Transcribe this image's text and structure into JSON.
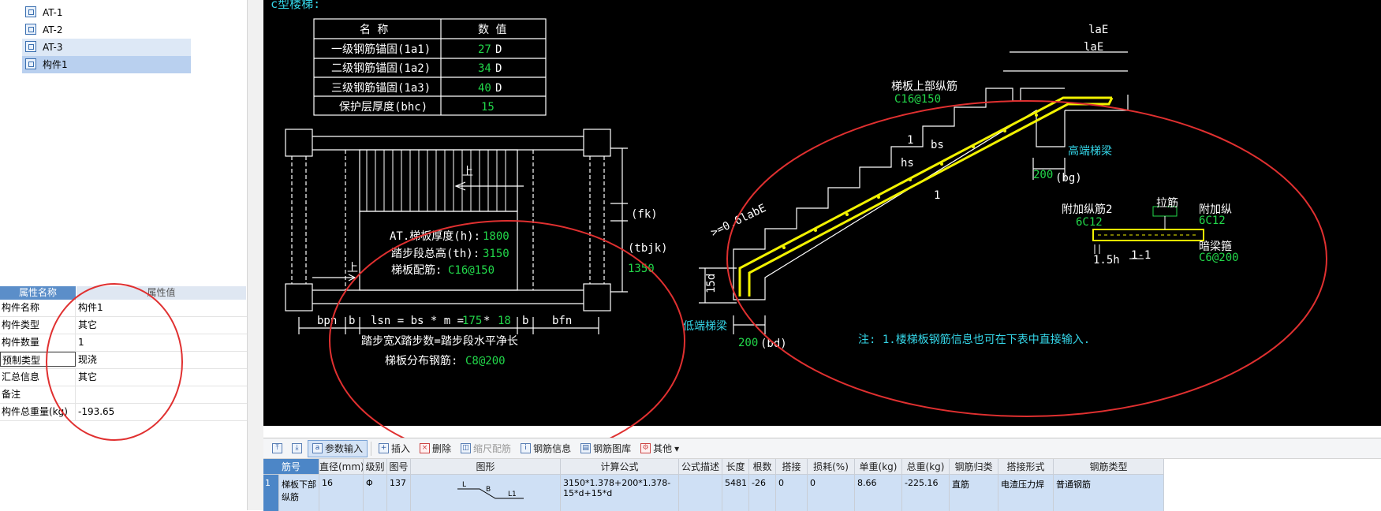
{
  "tree": {
    "items": [
      {
        "label": "AT-1"
      },
      {
        "label": "AT-2"
      },
      {
        "label": "AT-3"
      },
      {
        "label": "构件1"
      }
    ]
  },
  "props": {
    "headers": {
      "name": "属性名称",
      "value": "属性值"
    },
    "rows": [
      {
        "k": "构件名称",
        "v": "构件1"
      },
      {
        "k": "构件类型",
        "v": "其它"
      },
      {
        "k": "构件数量",
        "v": "1"
      },
      {
        "k": "预制类型",
        "v": "现浇"
      },
      {
        "k": "汇总信息",
        "v": "其它"
      },
      {
        "k": "备注",
        "v": ""
      },
      {
        "k": "构件总重量(kg)",
        "v": "-193.65"
      }
    ]
  },
  "cad": {
    "title": "AT c型楼梯:",
    "table": {
      "h_name": "名  称",
      "h_value": "数  值",
      "rows": [
        {
          "name": "一级钢筋锚固(1a1)",
          "val": "27",
          "unit": "D"
        },
        {
          "name": "二级钢筋锚固(1a2)",
          "val": "34",
          "unit": "D"
        },
        {
          "name": "三级钢筋锚固(1a3)",
          "val": "40",
          "unit": "D"
        },
        {
          "name": "保护层厚度(bhc)",
          "val": "15",
          "unit": ""
        }
      ]
    },
    "plan": {
      "up1": "上",
      "up2": "上",
      "h_label": "AT.梯板厚度(h):",
      "h_val": "1800",
      "th_label": "踏步段总高(th):",
      "th_val": "3150",
      "rebar_label": "梯板配筋:",
      "rebar_val": "C16@150",
      "fk": "(fk)",
      "tbjk": "(tbjk)",
      "dim1350": "1350",
      "bpn": "bpn",
      "b1": "b",
      "lsn_text": "lsn = bs * m =",
      "lsn_v1": "175",
      "lsn_star": "*",
      "lsn_v2": "18",
      "b2": "b",
      "bfn": "bfn",
      "note1": "踏步宽X踏步数=踏步段水平净长",
      "note2_label": "梯板分布钢筋:",
      "note2_val": "C8@200"
    },
    "section": {
      "laE1": "laE",
      "laE2": "laE",
      "top_bar_label": "梯板上部纵筋",
      "top_bar_val": "C16@150",
      "bs": "bs",
      "hs": "hs",
      "one_a": "1",
      "one_b": "1",
      "high_beam": "高端梯梁",
      "bg_val": "200",
      "bg": "(bg)",
      "anchor": ">=0.6labE",
      "d15": "15d",
      "low_beam": "低端梯梁",
      "bd_val": "200",
      "bd": "(bd)",
      "note": "注: 1.楼梯板钢筋信息也可在下表中直接输入."
    },
    "detail": {
      "tie": "拉筋",
      "add2": "附加纵筋2",
      "add2_val": "6C12",
      "add1": "附加纵",
      "add1_val": "6C12",
      "hidden": "暗梁箍",
      "hidden_val": "C6@200",
      "h15": "1.5h",
      "sec": "1-1"
    }
  },
  "toolbar": {
    "items": [
      {
        "label": "",
        "icon": "scroll-top-icon"
      },
      {
        "label": "",
        "icon": "scroll-bottom-icon"
      },
      {
        "label": "参数输入",
        "icon": "param-input-icon",
        "active": true
      },
      {
        "label": "插入",
        "icon": "insert-icon"
      },
      {
        "label": "删除",
        "icon": "delete-icon"
      },
      {
        "label": "缩尺配筋",
        "icon": "scale-rebar-icon",
        "disabled": true
      },
      {
        "label": "钢筋信息",
        "icon": "rebar-info-icon"
      },
      {
        "label": "钢筋图库",
        "icon": "rebar-library-icon"
      },
      {
        "label": "其他",
        "icon": "other-icon"
      }
    ]
  },
  "grid": {
    "headers": [
      "筋号",
      "直径(mm)",
      "级别",
      "图号",
      "图形",
      "计算公式",
      "公式描述",
      "长度",
      "根数",
      "搭接",
      "损耗(%)",
      "单重(kg)",
      "总重(kg)",
      "钢筋归类",
      "搭接形式",
      "钢筋类型"
    ],
    "row": {
      "num": "1",
      "name": "梯板下部纵筋",
      "dia": "16",
      "grade": "Φ",
      "fig": "137",
      "shape_L": "L",
      "shape_B": "B",
      "shape_L1": "L1",
      "formula": "3150*1.378+200*1.378-15*d+15*d",
      "desc": "",
      "len": "5481",
      "count": "-26",
      "lap": "0",
      "loss": "0",
      "unit_w": "8.66",
      "total_w": "-225.16",
      "cat": "直筋",
      "lap_form": "电渣压力焊",
      "type": "普通钢筋"
    }
  },
  "colors": {
    "cad_bg": "#000000",
    "cad_line": "#ffffff",
    "cad_green": "#22d84a",
    "cad_cyan": "#35d6e8",
    "cad_yellow": "#f2f200",
    "annot_red": "#e03030"
  }
}
